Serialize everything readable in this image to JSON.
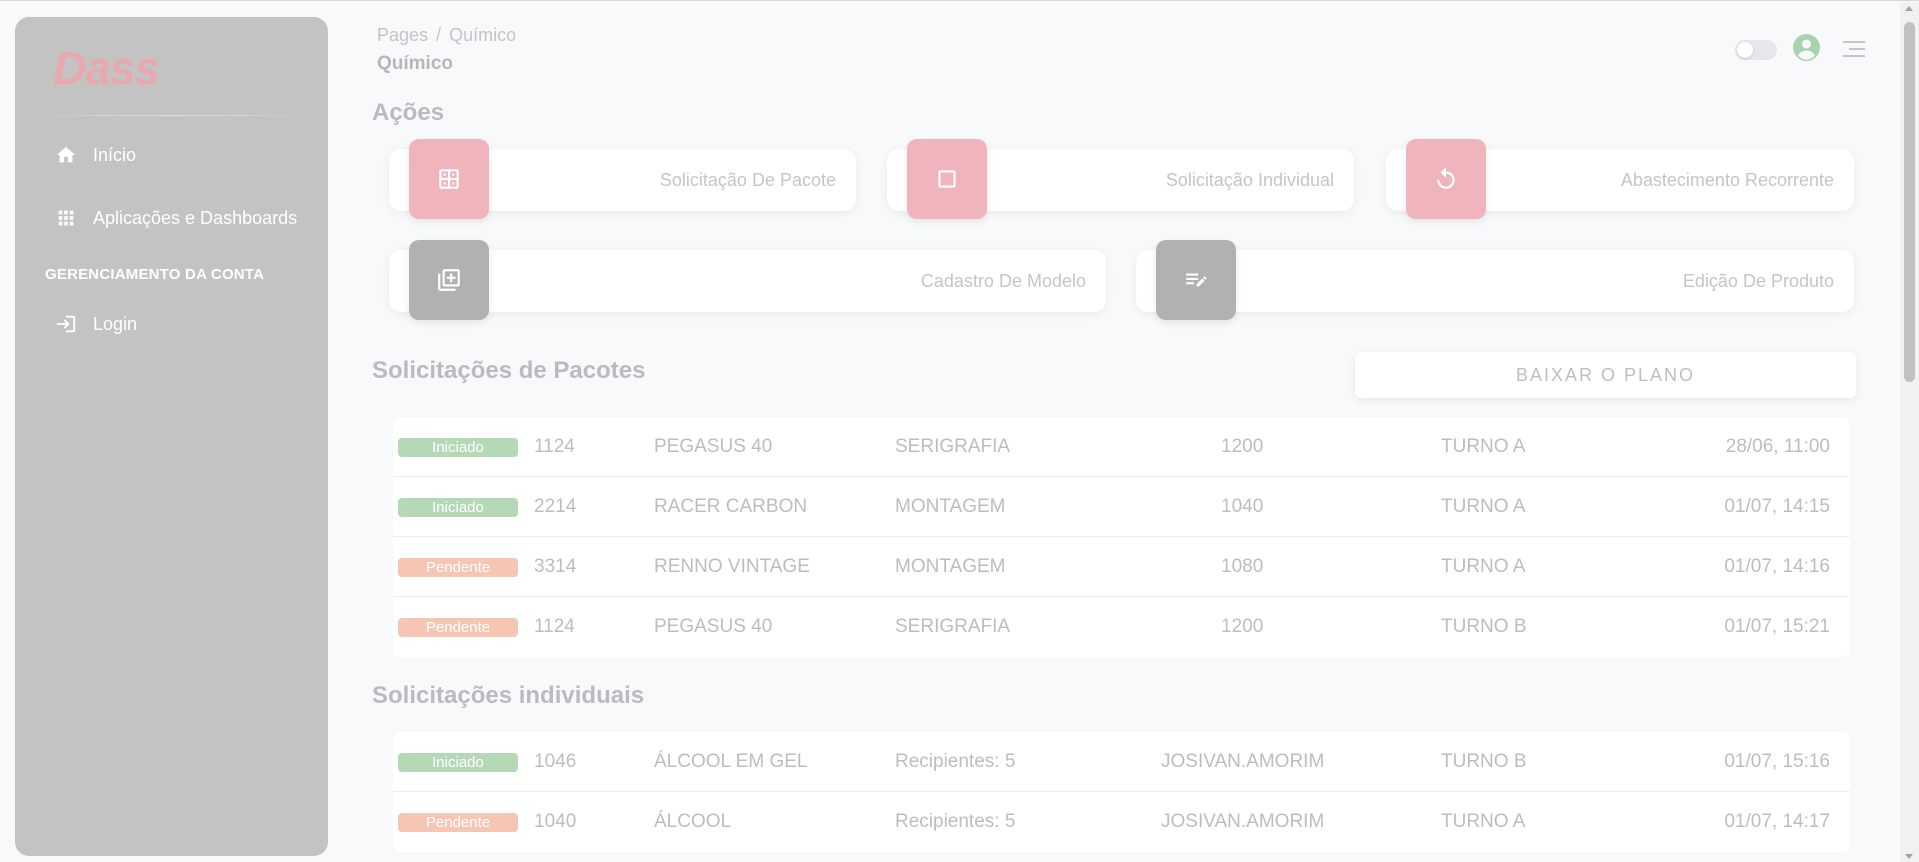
{
  "sidebar": {
    "brand": "Dass",
    "nav": [
      {
        "label": "Início",
        "icon": "home-icon"
      },
      {
        "label": "Aplicações e Dashboards",
        "icon": "apps-grid-icon"
      }
    ],
    "section_label": "GERENCIAMENTO DA CONTA",
    "account_nav": [
      {
        "label": "Login",
        "icon": "login-icon"
      }
    ]
  },
  "header": {
    "breadcrumb": [
      "Pages",
      "Químico"
    ],
    "breadcrumb_sep": "/",
    "title": "Químico"
  },
  "actions": {
    "title": "Ações",
    "cards": [
      {
        "label": "Solicitação De Pacote",
        "icon": "dashboard-grid-icon",
        "color": "#f0b4bd"
      },
      {
        "label": "Solicitação Individual",
        "icon": "square-icon",
        "color": "#f0b4bd"
      },
      {
        "label": "Abastecimento Recorrente",
        "icon": "refresh-icon",
        "color": "#f0b4bd"
      },
      {
        "label": "Cadastro De Modelo",
        "icon": "library-add-icon",
        "color": "#b1b1b1"
      },
      {
        "label": "Edição De Produto",
        "icon": "edit-note-icon",
        "color": "#b1b1b1"
      }
    ]
  },
  "packages": {
    "title": "Solicitações de Pacotes",
    "download_label": "BAIXAR O PLANO",
    "rows": [
      {
        "status": "Iniciado",
        "id": "1124",
        "model": "PEGASUS 40",
        "sector": "SERIGRAFIA",
        "qty": "1200",
        "shift": "TURNO A",
        "time": "28/06, 11:00"
      },
      {
        "status": "Iniciado",
        "id": "2214",
        "model": "RACER CARBON",
        "sector": "MONTAGEM",
        "qty": "1040",
        "shift": "TURNO A",
        "time": "01/07, 14:15"
      },
      {
        "status": "Pendente",
        "id": "3314",
        "model": "RENNO VINTAGE",
        "sector": "MONTAGEM",
        "qty": "1080",
        "shift": "TURNO A",
        "time": "01/07, 14:16"
      },
      {
        "status": "Pendente",
        "id": "1124",
        "model": "PEGASUS 40",
        "sector": "SERIGRAFIA",
        "qty": "1200",
        "shift": "TURNO B",
        "time": "01/07, 15:21"
      }
    ]
  },
  "individual": {
    "title": "Solicitações individuais",
    "rows": [
      {
        "status": "Iniciado",
        "id": "1046",
        "product": "ÁLCOOL EM GEL",
        "containers": "Recipientes: 5",
        "user": "JOSIVAN.AMORIM",
        "shift": "TURNO B",
        "time": "01/07, 15:16"
      },
      {
        "status": "Pendente",
        "id": "1040",
        "product": "ÁLCOOL",
        "containers": "Recipientes: 5",
        "user": "JOSIVAN.AMORIM",
        "shift": "TURNO A",
        "time": "01/07, 14:17"
      }
    ]
  },
  "colors": {
    "iniciado": "#b5d9b7",
    "pendente": "#f6c6b5",
    "sidebar": "#c3c3c3",
    "accent_pink": "#f0b4bd",
    "user_icon": "#a9d3ad"
  }
}
